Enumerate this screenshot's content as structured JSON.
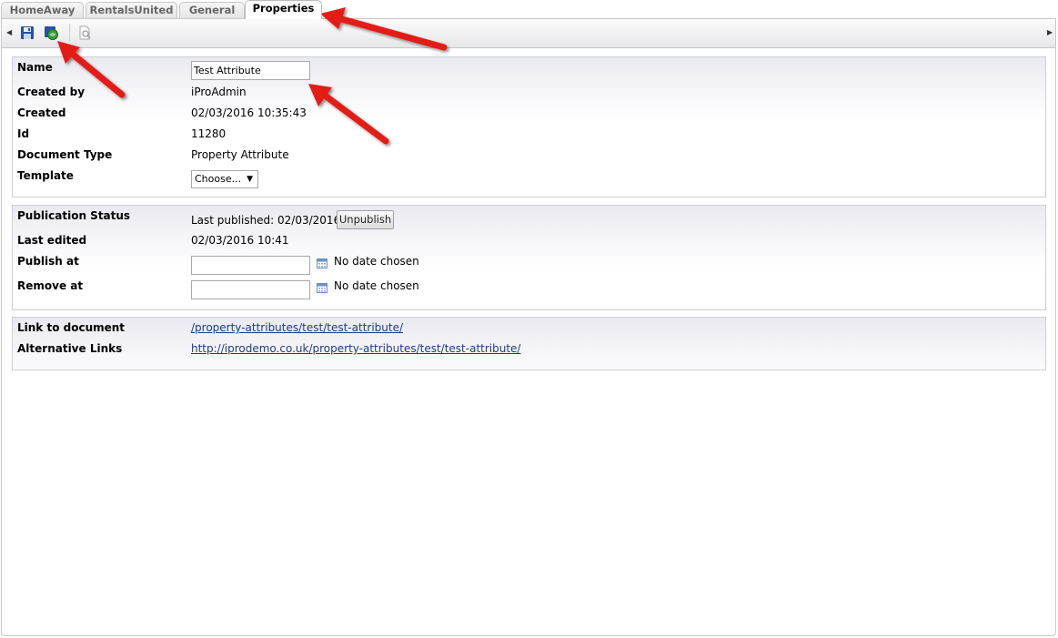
{
  "tabs": [
    {
      "label": "HomeAway"
    },
    {
      "label": "RentalsUnited"
    },
    {
      "label": "General"
    },
    {
      "label": "Properties"
    }
  ],
  "toolbar": {
    "icons": [
      "save-icon",
      "save-publish-icon",
      "preview-icon"
    ]
  },
  "properties": {
    "name_label": "Name",
    "name_value": "Test Attribute",
    "created_by_label": "Created by",
    "created_by_value": "iProAdmin",
    "created_label": "Created",
    "created_value": "02/03/2016 10:35:43",
    "id_label": "Id",
    "id_value": "11280",
    "doctype_label": "Document Type",
    "doctype_value": "Property Attribute",
    "template_label": "Template",
    "template_value": "Choose..."
  },
  "publication": {
    "status_label": "Publication Status",
    "status_value": "Last published: 02/03/2016",
    "unpublish_label": "Unpublish",
    "last_edited_label": "Last edited",
    "last_edited_value": "02/03/2016 10:41",
    "publish_at_label": "Publish at",
    "publish_at_value": "",
    "publish_at_status": "No date chosen",
    "remove_at_label": "Remove at",
    "remove_at_value": "",
    "remove_at_status": "No date chosen"
  },
  "links": {
    "link_label": "Link to document",
    "link_value": "/property-attributes/test/test-attribute/",
    "alt_label": "Alternative Links",
    "alt_value": "http://iprodemo.co.uk/property-attributes/test/test-attribute/"
  },
  "colors": {
    "annotation_arrow": "#e41b17",
    "link": "#1a3b8c"
  }
}
